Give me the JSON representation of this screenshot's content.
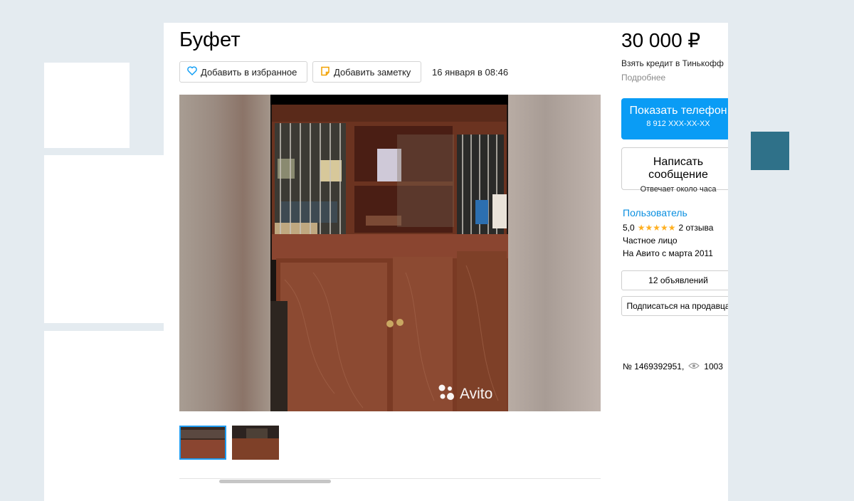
{
  "listing": {
    "title": "Буфет",
    "favorite_label": "Добавить в избранное",
    "note_label": "Добавить заметку",
    "date": "16 января в 08:46",
    "watermark": "Avito",
    "thumbnails": [
      "photo-1",
      "photo-2"
    ],
    "selected_thumbnail": 1
  },
  "sidebar": {
    "price": "30 000 ₽",
    "credit_text": "Взять кредит в Тинькофф",
    "more_link": "Подробнее",
    "show_phone_label": "Показать телефон",
    "phone_partial": "8 912 XXX-XX-XX",
    "write_label": "Написать сообщение",
    "write_subtitle": "Отвечает около часа",
    "seller_name": "Пользователь",
    "rating": "5,0",
    "reviews": "2 отзыва",
    "seller_type": "Частное лицо",
    "since": "На Авито с марта 2011",
    "ads_label": "12 объявлений",
    "subscribe_label": "Подписаться на продавца",
    "ad_number": "№ 1469392951,",
    "views": "1003"
  },
  "colors": {
    "accent_blue": "#0a9cf5",
    "link_blue": "#0a8fe0",
    "star": "#ffb021",
    "background": "#e4ebf0",
    "decor_teal": "#2f7189"
  },
  "icons": {
    "favorite": "heart-icon",
    "note": "note-icon",
    "views": "eye-icon",
    "watermark": "avito-logo-icon"
  }
}
